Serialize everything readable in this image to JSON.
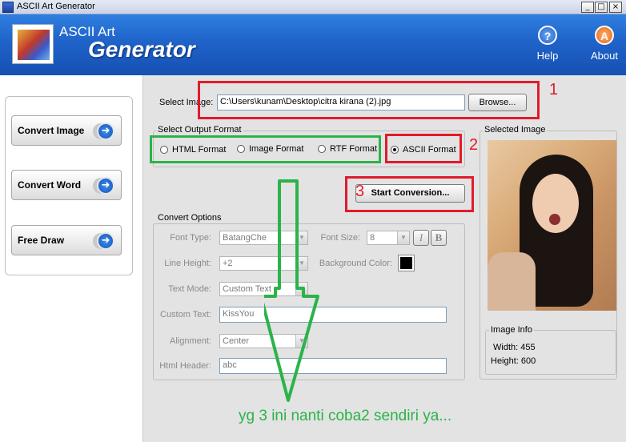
{
  "window": {
    "title": "ASCII Art Generator",
    "min": "_",
    "max": "□",
    "close": "×"
  },
  "header": {
    "title1": "ASCII Art",
    "title2": "Generator",
    "help": "Help",
    "about": "About",
    "help_glyph": "?",
    "about_glyph": "A"
  },
  "nav": {
    "items": [
      {
        "label": "Convert Image"
      },
      {
        "label": "Convert Word"
      },
      {
        "label": "Free Draw"
      }
    ]
  },
  "select_image": {
    "label": "Select Image:",
    "value": "C:\\Users\\kunam\\Desktop\\citra kirana (2).jpg",
    "browse": "Browse..."
  },
  "output_format": {
    "title": "Select Output Format",
    "options": [
      "HTML Format",
      "Image Format",
      "RTF Format",
      "ASCII Format"
    ],
    "selected": "ASCII Format"
  },
  "start_button": "Start Conversion...",
  "convert_options": {
    "title": "Convert Options",
    "font_type_label": "Font Type:",
    "font_type": "BatangChe",
    "font_size_label": "Font Size:",
    "font_size": "8",
    "italic": "I",
    "bold": "B",
    "line_height_label": "Line Height:",
    "line_height": "+2",
    "bg_color_label": "Background Color:",
    "bg_color": "#000000",
    "text_mode_label": "Text Mode:",
    "text_mode": "Custom Text",
    "custom_text_label": "Custom Text:",
    "custom_text": "KissYou",
    "alignment_label": "Alignment:",
    "alignment": "Center",
    "html_header_label": "Html Header:",
    "html_header": "abc"
  },
  "selected_image": {
    "title": "Selected Image"
  },
  "image_info": {
    "title": "Image Info",
    "width": "Width: 455",
    "height": "Height: 600"
  },
  "annotations": {
    "n1": "1",
    "n2": "2",
    "n3": "3",
    "note": "yg 3 ini nanti coba2 sendiri ya..."
  },
  "colors": {
    "header": "#1f63c9",
    "red": "#e11b2a",
    "green": "#2bb34a"
  }
}
